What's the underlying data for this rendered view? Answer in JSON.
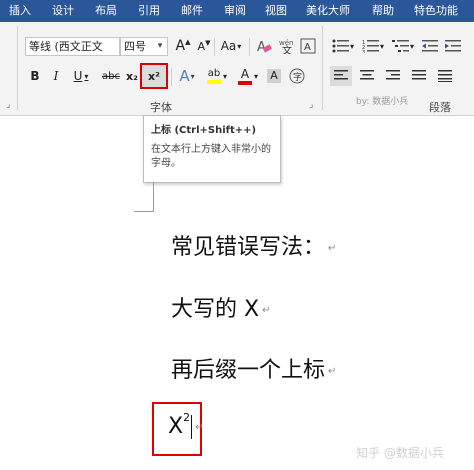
{
  "tabs": [
    "插入",
    "设计",
    "布局",
    "引用",
    "邮件",
    "审阅",
    "视图",
    "美化大师",
    "帮助",
    "特色功能"
  ],
  "font": {
    "name_value": "等线 (西文正文",
    "size_value": "四号",
    "grow_label": "A",
    "shrink_label": "A",
    "case_label": "Aa",
    "bold_label": "B",
    "italic_label": "I",
    "underline_label": "U",
    "strike_label": "abc",
    "subscript_label": "x₂",
    "superscript_label": "x²",
    "effects_label": "A",
    "highlight_label": "ab",
    "color_label": "A",
    "char_border_label": "A",
    "group_label": "字体"
  },
  "paragraph": {
    "group_label": "段落",
    "inner_watermark": "by: 数据小兵"
  },
  "tooltip": {
    "title": "上标 (Ctrl+Shift++)",
    "description": "在文本行上方键入非常小的字母。"
  },
  "document": {
    "line1": "常见错误写法：",
    "line2": "大写的 X",
    "line3": "再后缀一个上标",
    "line4_base": "X",
    "line4_sup": "2",
    "para_mark": "↵"
  },
  "watermark": "知乎 @数据小兵",
  "colors": {
    "ribbon_tab_bar": "#2b579a",
    "ribbon_body": "#f3f3f3",
    "highlight_box": "#e00000",
    "font_color_bar": "#e00000",
    "highlight_bar": "#ffff00"
  }
}
